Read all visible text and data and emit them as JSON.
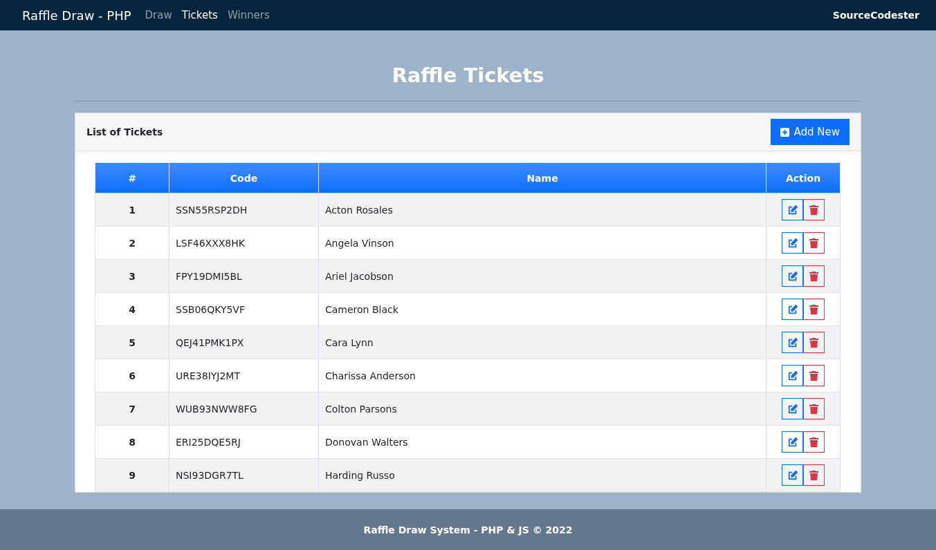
{
  "navbar": {
    "brand": "Raffle Draw - PHP",
    "links": [
      {
        "label": "Draw",
        "selected": false
      },
      {
        "label": "Tickets",
        "selected": true
      },
      {
        "label": "Winners",
        "selected": false
      }
    ],
    "right_text": "SourceCodester"
  },
  "page_title": "Raffle Tickets",
  "card": {
    "title": "List of Tickets",
    "add_button": "Add New"
  },
  "table": {
    "columns": [
      "#",
      "Code",
      "Name",
      "Action"
    ],
    "rows": [
      {
        "number": "1",
        "code": "SSN55RSP2DH",
        "name": "Acton Rosales"
      },
      {
        "number": "2",
        "code": "LSF46XXX8HK",
        "name": "Angela Vinson"
      },
      {
        "number": "3",
        "code": "FPY19DMI5BL",
        "name": "Ariel Jacobson"
      },
      {
        "number": "4",
        "code": "SSB06QKY5VF",
        "name": "Cameron Black"
      },
      {
        "number": "5",
        "code": "QEJ41PMK1PX",
        "name": "Cara Lynn"
      },
      {
        "number": "6",
        "code": "URE38IYJ2MT",
        "name": "Charissa Anderson"
      },
      {
        "number": "7",
        "code": "WUB93NWW8FG",
        "name": "Colton Parsons"
      },
      {
        "number": "8",
        "code": "ERI25DQE5RJ",
        "name": "Donovan Walters"
      },
      {
        "number": "9",
        "code": "NSI93DGR7TL",
        "name": "Harding Russo"
      }
    ]
  },
  "footer": "Raffle Draw System - PHP & JS © 2022"
}
